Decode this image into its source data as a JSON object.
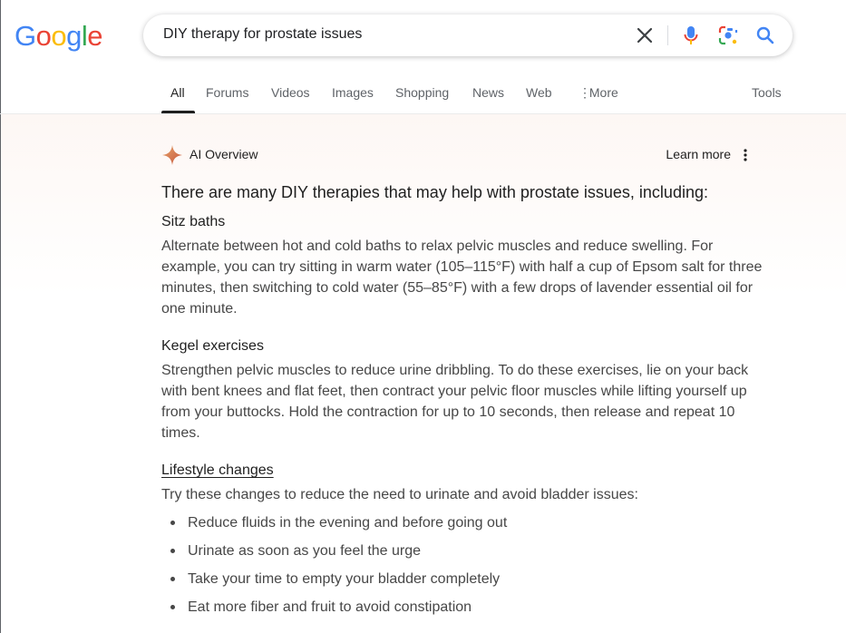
{
  "logo": {
    "text": "Google",
    "letters": [
      "G",
      "o",
      "o",
      "g",
      "l",
      "e"
    ],
    "colors": [
      "#4285F4",
      "#EA4335",
      "#FBBC05",
      "#4285F4",
      "#34A853",
      "#EA4335"
    ]
  },
  "search": {
    "query": "DIY therapy for prostate issues",
    "icons": [
      "close-icon",
      "mic-icon",
      "lens-icon",
      "search-icon"
    ]
  },
  "tabs": [
    {
      "label": "All",
      "active": true
    },
    {
      "label": "Forums"
    },
    {
      "label": "Videos"
    },
    {
      "label": "Images"
    },
    {
      "label": "Shopping"
    },
    {
      "label": "News"
    },
    {
      "label": "Web"
    },
    {
      "label": "More"
    }
  ],
  "tools_label": "Tools",
  "ai_overview": {
    "title": "AI Overview",
    "learn_more": "Learn more",
    "intro": "There are many DIY therapies that may help with prostate issues, including:",
    "sections": [
      {
        "title": "Sitz baths",
        "body": "Alternate between hot and cold baths to relax pelvic muscles and reduce swelling. For example, you can try sitting in warm water (105–115°F) with half a cup of Epsom salt for three minutes, then switching to cold water (55–85°F) with a few drops of lavender essential oil for one minute."
      },
      {
        "title": "Kegel exercises",
        "body": "Strengthen pelvic muscles to reduce urine dribbling. To do these exercises, lie on your back with bent knees and flat feet, then contract your pelvic floor muscles while lifting yourself up from your buttocks. Hold the contraction for up to 10 seconds, then release and repeat 10 times."
      },
      {
        "title": "Lifestyle changes",
        "body": "Try these changes to reduce the need to urinate and avoid bladder issues:",
        "bullets": [
          "Reduce fluids in the evening and before going out",
          "Urinate as soon as you feel the urge",
          "Take your time to empty your bladder completely",
          "Eat more fiber and fruit to avoid constipation"
        ]
      }
    ]
  },
  "colors": {
    "accent": "#1a73e8",
    "text": "#1f1f1f",
    "secondary": "#5f6368"
  }
}
